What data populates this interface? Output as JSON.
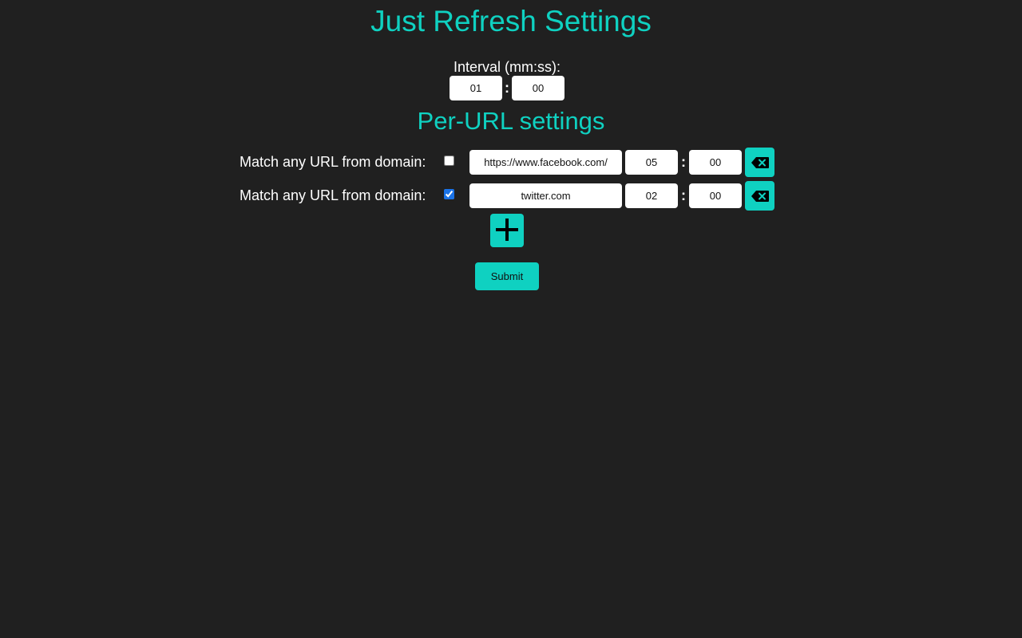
{
  "header": {
    "title": "Just Refresh Settings"
  },
  "interval": {
    "label": "Interval (mm:ss):",
    "minutes": "01",
    "seconds": "00",
    "separator": ":"
  },
  "per_url": {
    "title": "Per-URL settings",
    "rows": [
      {
        "label": "Match any URL from domain:",
        "match_domain": false,
        "url": "https://www.facebook.com/",
        "minutes": "05",
        "seconds": "00",
        "separator": ":",
        "delete_icon": "backspace-icon"
      },
      {
        "label": "Match any URL from domain:",
        "match_domain": true,
        "url": "twitter.com",
        "minutes": "02",
        "seconds": "00",
        "separator": ":",
        "delete_icon": "backspace-icon"
      }
    ],
    "add_icon": "plus-icon"
  },
  "actions": {
    "submit_label": "Submit"
  },
  "colors": {
    "background": "#202020",
    "accent": "#0fd1c1",
    "text": "#ffffff",
    "field_background": "#ffffff",
    "checkbox_checked": "#1a73e8"
  }
}
